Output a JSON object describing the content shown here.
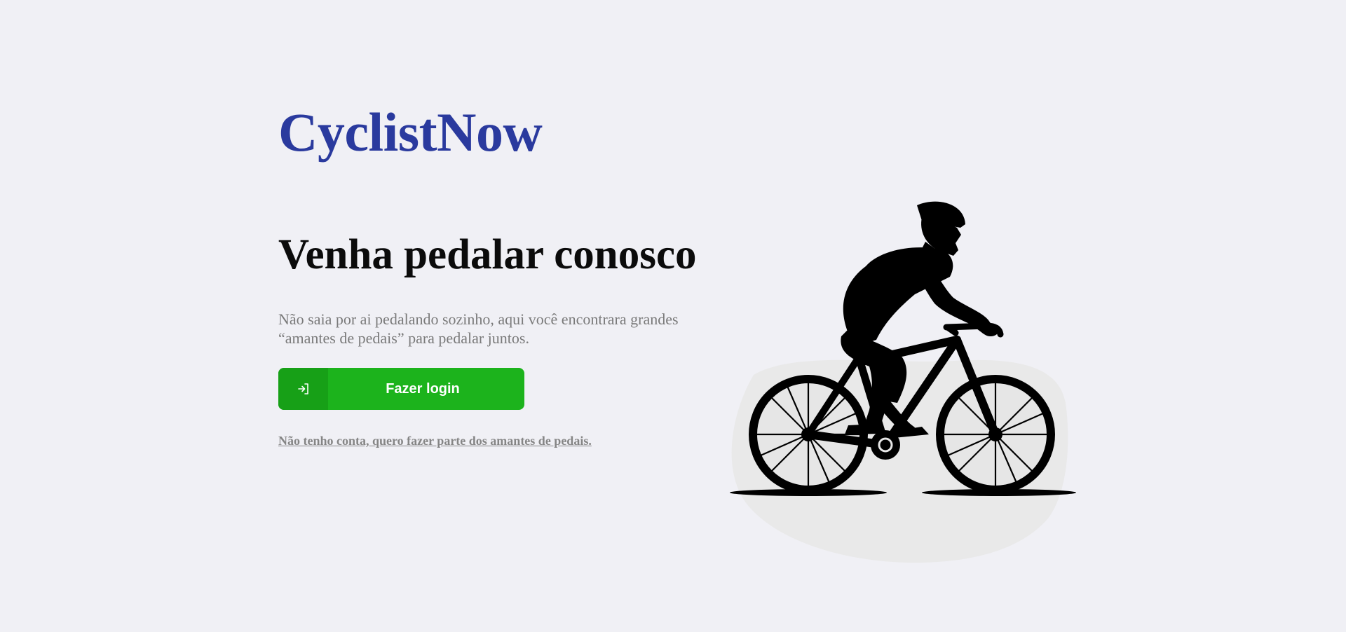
{
  "brand": {
    "name": "CyclistNow",
    "color": "#2a3a9e"
  },
  "hero": {
    "headline": "Venha pedalar conosco",
    "description": "Não saia por ai pedalando sozinho, aqui você encontrara grandes “amantes de pedais” para pedalar juntos."
  },
  "login_button": {
    "label": "Fazer login",
    "icon": "login-arrow-icon",
    "color": "#1cb31c"
  },
  "signup_link": {
    "label": "Não tenho conta, quero fazer parte dos amantes de pedais."
  },
  "illustration": {
    "icon": "cyclist-silhouette-icon"
  }
}
